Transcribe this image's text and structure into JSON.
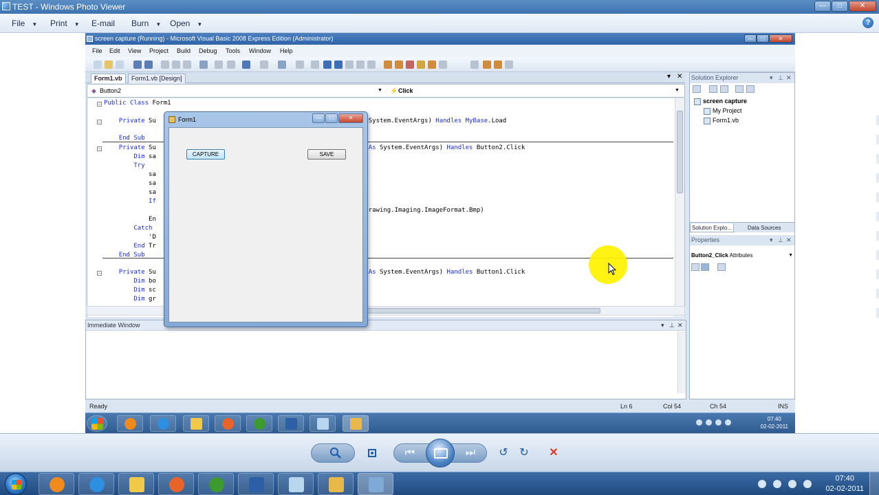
{
  "photo_viewer": {
    "title": "TEST - Windows Photo Viewer",
    "window_controls": {
      "minimize": "—",
      "maximize": "□",
      "close": "✕"
    },
    "menu": [
      {
        "label": "File",
        "has_arrow": true
      },
      {
        "label": "Print",
        "has_arrow": true
      },
      {
        "label": "E-mail",
        "has_arrow": false
      },
      {
        "label": "Burn",
        "has_arrow": true
      },
      {
        "label": "Open",
        "has_arrow": true
      }
    ],
    "help": "?"
  },
  "vs": {
    "title": "screen capture (Running) - Microsoft Visual Basic 2008 Express Edition (Administrator)",
    "window_controls": {
      "minimize": "—",
      "maximize": "□",
      "close": "✕"
    },
    "menu": [
      "File",
      "Edit",
      "View",
      "Project",
      "Build",
      "Debug",
      "Tools",
      "Window",
      "Help"
    ],
    "doc_tabs": [
      {
        "label": "Form1.vb",
        "active": true
      },
      {
        "label": "Form1.vb [Design]",
        "active": false
      }
    ],
    "doc_tab_controls": {
      "dropdown": "▾",
      "close": "✕"
    },
    "object_dropdown": "Button2",
    "event_dropdown": "Click",
    "code_lines": [
      {
        "text": "Public Class Form1",
        "fold": "−"
      },
      {
        "text": "    Private Su                                                    e As System.EventArgs) Handles MyBase.Load",
        "fold": "−"
      },
      {
        "text": "    End Sub",
        "fold": ""
      },
      {
        "text": "    Private Su                                                   Val e As System.EventArgs) Handles Button2.Click",
        "fold": "−"
      },
      {
        "text": "        Dim sa",
        "fold": ""
      },
      {
        "text": "        Try",
        "fold": ""
      },
      {
        "text": "            sa",
        "fold": ""
      },
      {
        "text": "            sa",
        "fold": ""
      },
      {
        "text": "            sa",
        "fold": ""
      },
      {
        "text": "            If                                                  hen",
        "fold": ""
      },
      {
        "text": "                                                               System.Drawing.Imaging.ImageFormat.Bmp)",
        "fold": ""
      },
      {
        "text": "            En",
        "fold": ""
      },
      {
        "text": "        Catch",
        "fold": ""
      },
      {
        "text": "            'D",
        "fold": ""
      },
      {
        "text": "        End Tr",
        "fold": ""
      },
      {
        "text": "    End Sub",
        "fold": ""
      },
      {
        "text": "    Private Su                                                   Val e As System.EventArgs) Handles Button1.Click",
        "fold": "−"
      },
      {
        "text": "        Dim bo",
        "fold": ""
      },
      {
        "text": "        Dim sc",
        "fold": ""
      },
      {
        "text": "        Dim gr",
        "fold": ""
      }
    ],
    "immediate_window": {
      "title": "Immediate Window",
      "controls": {
        "dropdown": "▾",
        "pin": "⊥",
        "close": "✕"
      }
    },
    "solution_explorer": {
      "title": "Solution Explorer",
      "controls": {
        "dropdown": "▾",
        "pin": "⊥",
        "close": "✕"
      },
      "tree": [
        {
          "label": "screen capture",
          "bold": true,
          "level": 0
        },
        {
          "label": "My Project",
          "bold": false,
          "level": 1
        },
        {
          "label": "Form1.vb",
          "bold": false,
          "level": 1
        }
      ],
      "tabs": [
        "Solution Explo...",
        "Data Sources"
      ]
    },
    "properties": {
      "title": "Properties",
      "controls": {
        "dropdown": "▾",
        "pin": "⊥",
        "close": "✕"
      },
      "selected_object": "Button2_Click",
      "selected_type": "Attributes"
    },
    "status": {
      "text": "Ready",
      "ln": "Ln 6",
      "col": "Col 54",
      "ch": "Ch 54",
      "ins": "INS"
    },
    "taskbar": {
      "time": "07:40",
      "date": "02-02-2011"
    }
  },
  "form1": {
    "title": "Form1",
    "window_controls": {
      "minimize": "—",
      "maximize": "□",
      "close": "✕"
    },
    "capture_label": "CAPTURE",
    "save_label": "SAVE"
  },
  "os_taskbar": {
    "time": "07:40",
    "date": "02-02-2011"
  },
  "colors": {
    "code_keyword": "#1a2cd6",
    "cursor_highlight": "#fff200",
    "taskbar": "#2e5a8e"
  }
}
